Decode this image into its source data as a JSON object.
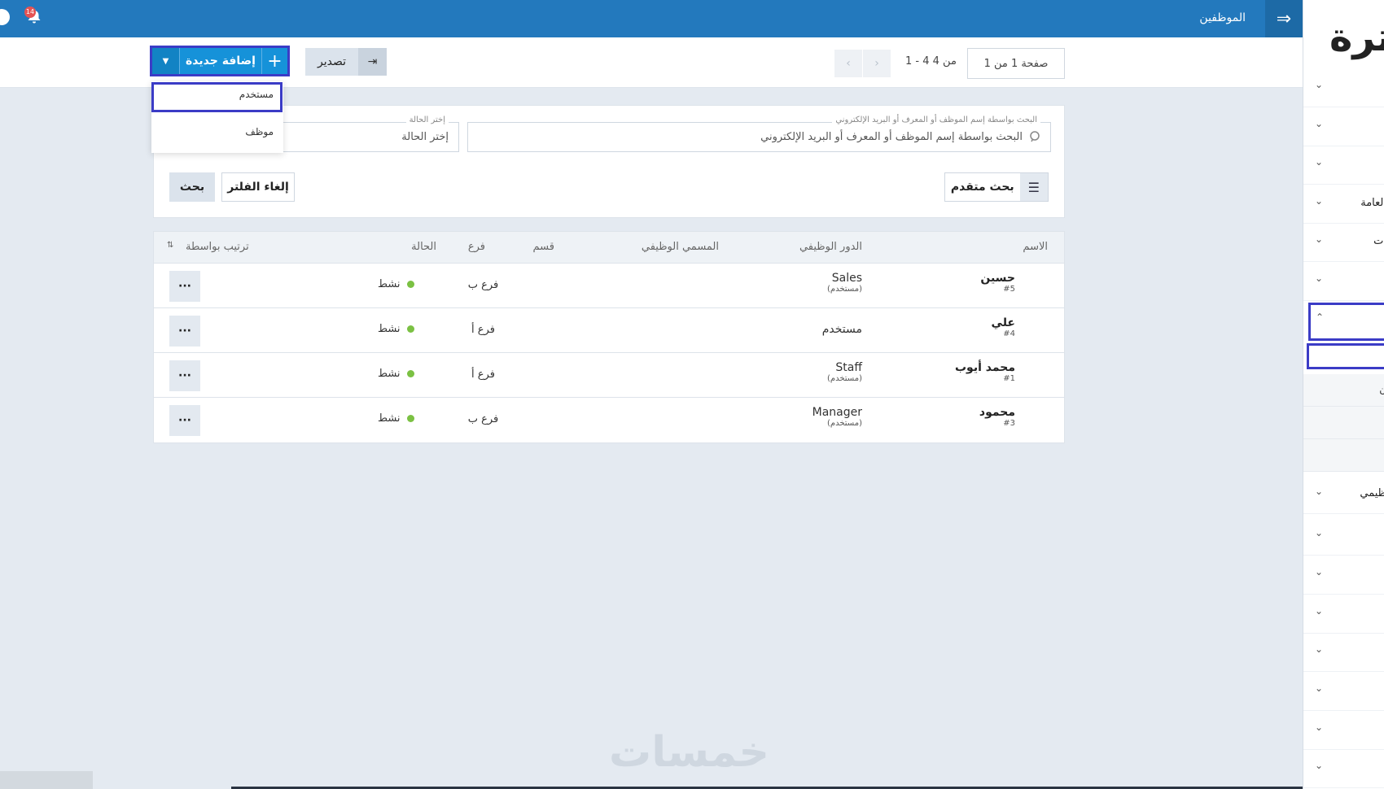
{
  "header": {
    "title": "الموظفين",
    "notifications_count": "14"
  },
  "sidebar": {
    "logo_text": "ترة",
    "items": [
      {
        "label": ""
      },
      {
        "label": ""
      },
      {
        "label": ""
      },
      {
        "label": "العامة"
      },
      {
        "label": "ات"
      },
      {
        "label": ""
      },
      {
        "label": ""
      },
      {
        "label": "ن"
      },
      {
        "label": "ظيمي"
      }
    ]
  },
  "toolbar": {
    "add_new_label": "إضافة جديدة",
    "export_label": "تصدير",
    "page_info": "صفحة 1 من 1",
    "range_info": "1 - 4 من 4"
  },
  "add_menu": {
    "items": [
      "مستخدم",
      "موظف"
    ]
  },
  "filters": {
    "search_legend": "البحث بواسطة إسم الموظف أو المعرف أو البريد الإلكتروني",
    "search_placeholder": "البحث بواسطة إسم الموظف أو المعرف أو البريد الإلكتروني",
    "status_legend": "إختر الحالة",
    "status_value": "إختر الحالة",
    "advanced_search": "بحث متقدم",
    "clear_filter": "إلغاء الفلتر",
    "search_button": "بحث"
  },
  "table": {
    "headers": {
      "name": "الاسم",
      "role": "الدور الوظيفي",
      "job_title": "المسمي الوظيفي",
      "department": "قسم",
      "branch": "فرع",
      "status": "الحالة",
      "sort_by": "ترتيب بواسطة"
    },
    "rows": [
      {
        "name": "حسين",
        "id": "#5",
        "role": "Sales",
        "role_sub": "(مستخدم)",
        "branch": "فرع ب",
        "status": "نشط"
      },
      {
        "name": "علي",
        "id": "#4",
        "role": "مستخدم",
        "role_sub": "",
        "branch": "فرع أ",
        "status": "نشط"
      },
      {
        "name": "محمد أيوب",
        "id": "#1",
        "role": "Staff",
        "role_sub": "(مستخدم)",
        "branch": "فرع أ",
        "status": "نشط"
      },
      {
        "name": "محمود",
        "id": "#3",
        "role": "Manager",
        "role_sub": "(مستخدم)",
        "branch": "فرع ب",
        "status": "نشط"
      }
    ],
    "more_label": "···"
  },
  "watermark": "خمسات",
  "colors": {
    "primary": "#2379bd",
    "accent": "#1692d9",
    "highlight_border": "#3b3cc6",
    "status_active": "#7bc143"
  }
}
